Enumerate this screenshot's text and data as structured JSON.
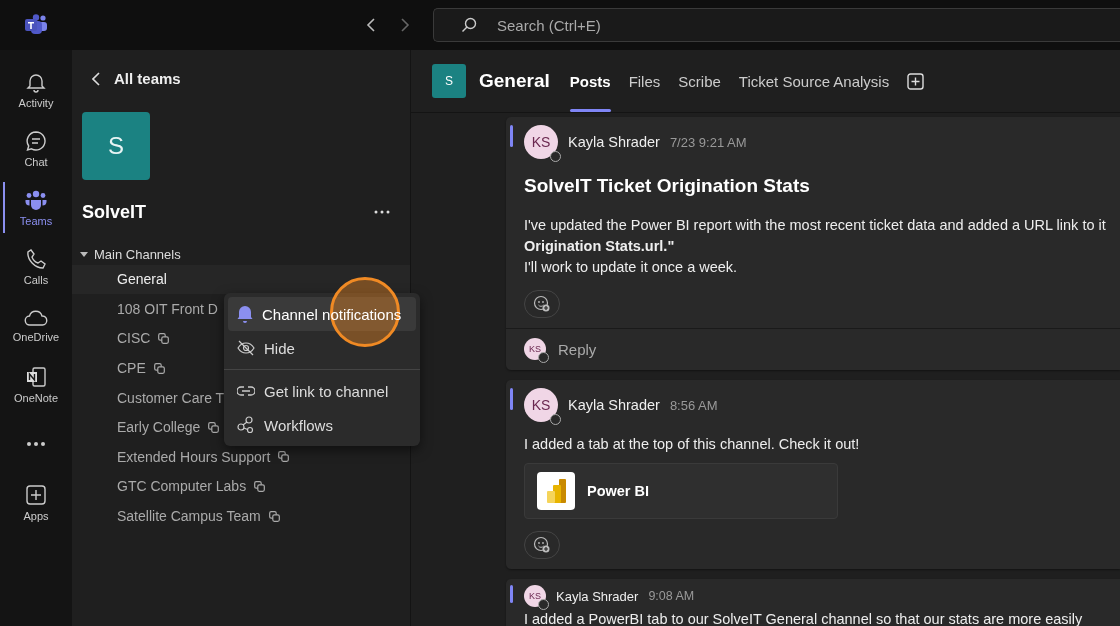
{
  "app_bar": {
    "search_placeholder": "Search (Ctrl+E)"
  },
  "rail": [
    {
      "label": "Activity",
      "selected": false
    },
    {
      "label": "Chat",
      "selected": false
    },
    {
      "label": "Teams",
      "selected": true
    },
    {
      "label": "Calls",
      "selected": false
    },
    {
      "label": "OneDrive",
      "selected": false
    },
    {
      "label": "OneNote",
      "selected": false
    },
    {
      "selected": false
    },
    {
      "label": "Apps",
      "selected": false
    }
  ],
  "sidebar": {
    "back": "All teams",
    "team": {
      "initial": "S",
      "name": "SolveIT"
    },
    "section": {
      "label": "Main Channels",
      "expanded": true,
      "channels": [
        {
          "name": "General",
          "shared": false,
          "selected": true
        },
        {
          "name": "108 OIT Front D",
          "shared": false,
          "selected": false
        },
        {
          "name": "CISC",
          "shared": true,
          "selected": false
        },
        {
          "name": "CPE",
          "shared": true,
          "selected": false
        },
        {
          "name": "Customer Care T",
          "shared": false,
          "selected": false
        },
        {
          "name": "Early College",
          "shared": true,
          "selected": false
        },
        {
          "name": "Extended Hours Support",
          "shared": true,
          "selected": false
        },
        {
          "name": "GTC Computer Labs",
          "shared": true,
          "selected": false
        },
        {
          "name": "Satellite Campus Team",
          "shared": true,
          "selected": false
        }
      ]
    }
  },
  "context_menu": [
    [
      {
        "label": "Channel notifications",
        "highlighted": true
      },
      {
        "label": "Hide",
        "highlighted": false
      }
    ],
    [
      {
        "label": "Get link to channel",
        "highlighted": false
      },
      {
        "label": "Workflows",
        "highlighted": false
      }
    ]
  ],
  "channel_header": {
    "initial": "S",
    "name": "General",
    "tabs": [
      {
        "label": "Posts",
        "selected": true
      },
      {
        "label": "Files",
        "selected": false
      },
      {
        "label": "Scribe",
        "selected": false
      },
      {
        "label": "Ticket Source Analysis",
        "selected": false
      }
    ]
  },
  "posts": [
    {
      "author": "Kayla Shrader",
      "initials": "KS",
      "time": "7/23 9:21 AM",
      "title": "SolveIT Ticket Origination Stats",
      "lines": [
        {
          "text": "I've updated the Power BI report with the most recent ticket data and added a URL link to it",
          "bold": false
        },
        {
          "text": "Origination Stats.url.\"",
          "bold": true
        },
        {
          "text": "I'll work to update it once a week.",
          "bold": false
        }
      ],
      "kind": "full",
      "reply": {
        "initials": "KS",
        "label": "Reply"
      }
    },
    {
      "author": "Kayla Shrader",
      "initials": "KS",
      "time": "8:56 AM",
      "lines": [
        {
          "text": "I added a tab at the top of this channel. Check it out!",
          "bold": false
        }
      ],
      "attachment": "Power BI",
      "kind": "full"
    },
    {
      "author": "Kayla Shrader",
      "initials": "KS",
      "time": "9:08 AM",
      "kind": "compact",
      "lines": [
        {
          "text": "I added a PowerBI tab to our SolveIT General channel so that our stats are more easily",
          "bold": false
        }
      ]
    }
  ]
}
